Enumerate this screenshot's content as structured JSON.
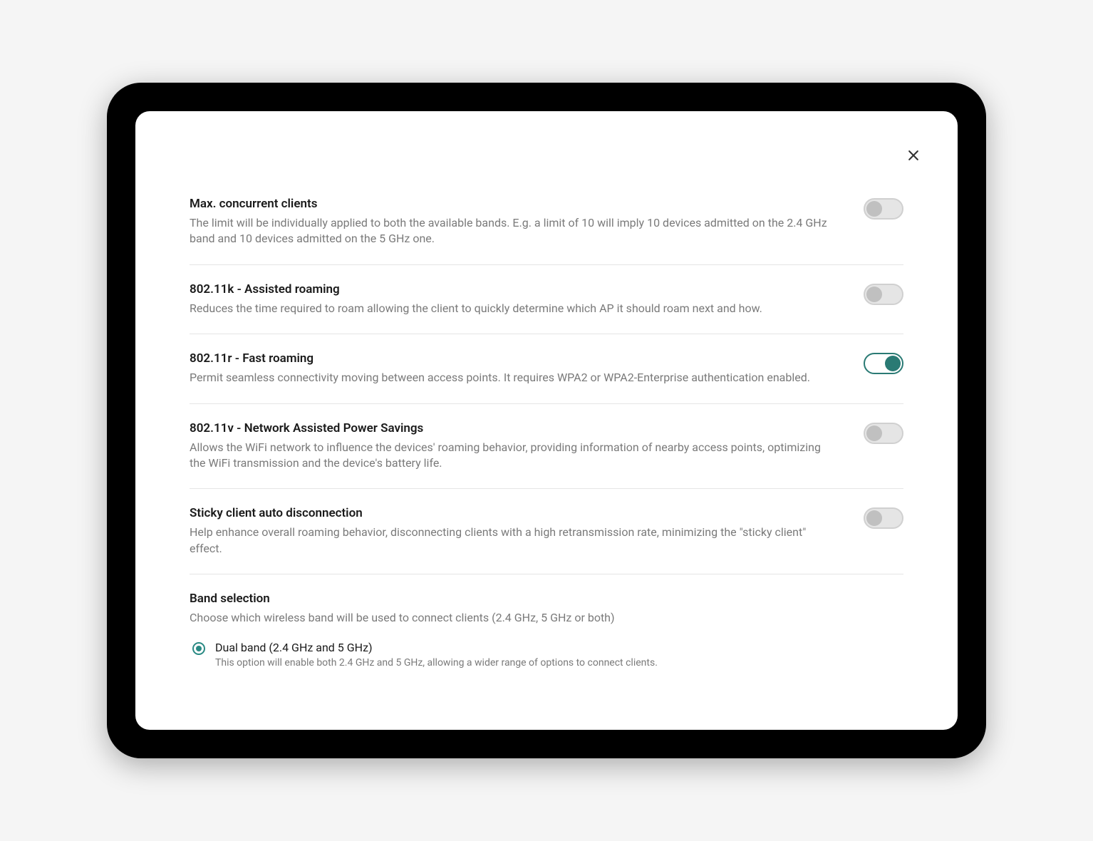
{
  "settings": [
    {
      "title": "Max. concurrent clients",
      "description": "The limit will be individually applied to both the available bands. E.g. a limit of 10 will imply 10 devices admitted on the 2.4 GHz band and 10 devices admitted on the 5 GHz one.",
      "enabled": false
    },
    {
      "title": "802.11k - Assisted roaming",
      "description": "Reduces the time required to roam allowing the client to quickly determine which AP it should roam next and how.",
      "enabled": false
    },
    {
      "title": "802.11r - Fast roaming",
      "description": "Permit seamless connectivity moving between access points. It requires WPA2 or WPA2-Enterprise authentication enabled.",
      "enabled": true
    },
    {
      "title": "802.11v - Network Assisted Power Savings",
      "description": "Allows the WiFi network to influence the devices' roaming behavior, providing information of nearby access points, optimizing the WiFi transmission and the device's battery life.",
      "enabled": false
    },
    {
      "title": "Sticky client auto disconnection",
      "description": "Help enhance overall roaming behavior, disconnecting clients with a high retransmission rate, minimizing the \"sticky client\" effect.",
      "enabled": false
    }
  ],
  "band_section": {
    "title": "Band selection",
    "description": "Choose which wireless band will be used to connect clients (2.4 GHz, 5 GHz or both)",
    "selected_option": {
      "label": "Dual band (2.4 GHz and 5 GHz)",
      "description": "This option will enable both 2.4 GHz and 5 GHz, allowing a wider range of options to connect clients."
    }
  }
}
